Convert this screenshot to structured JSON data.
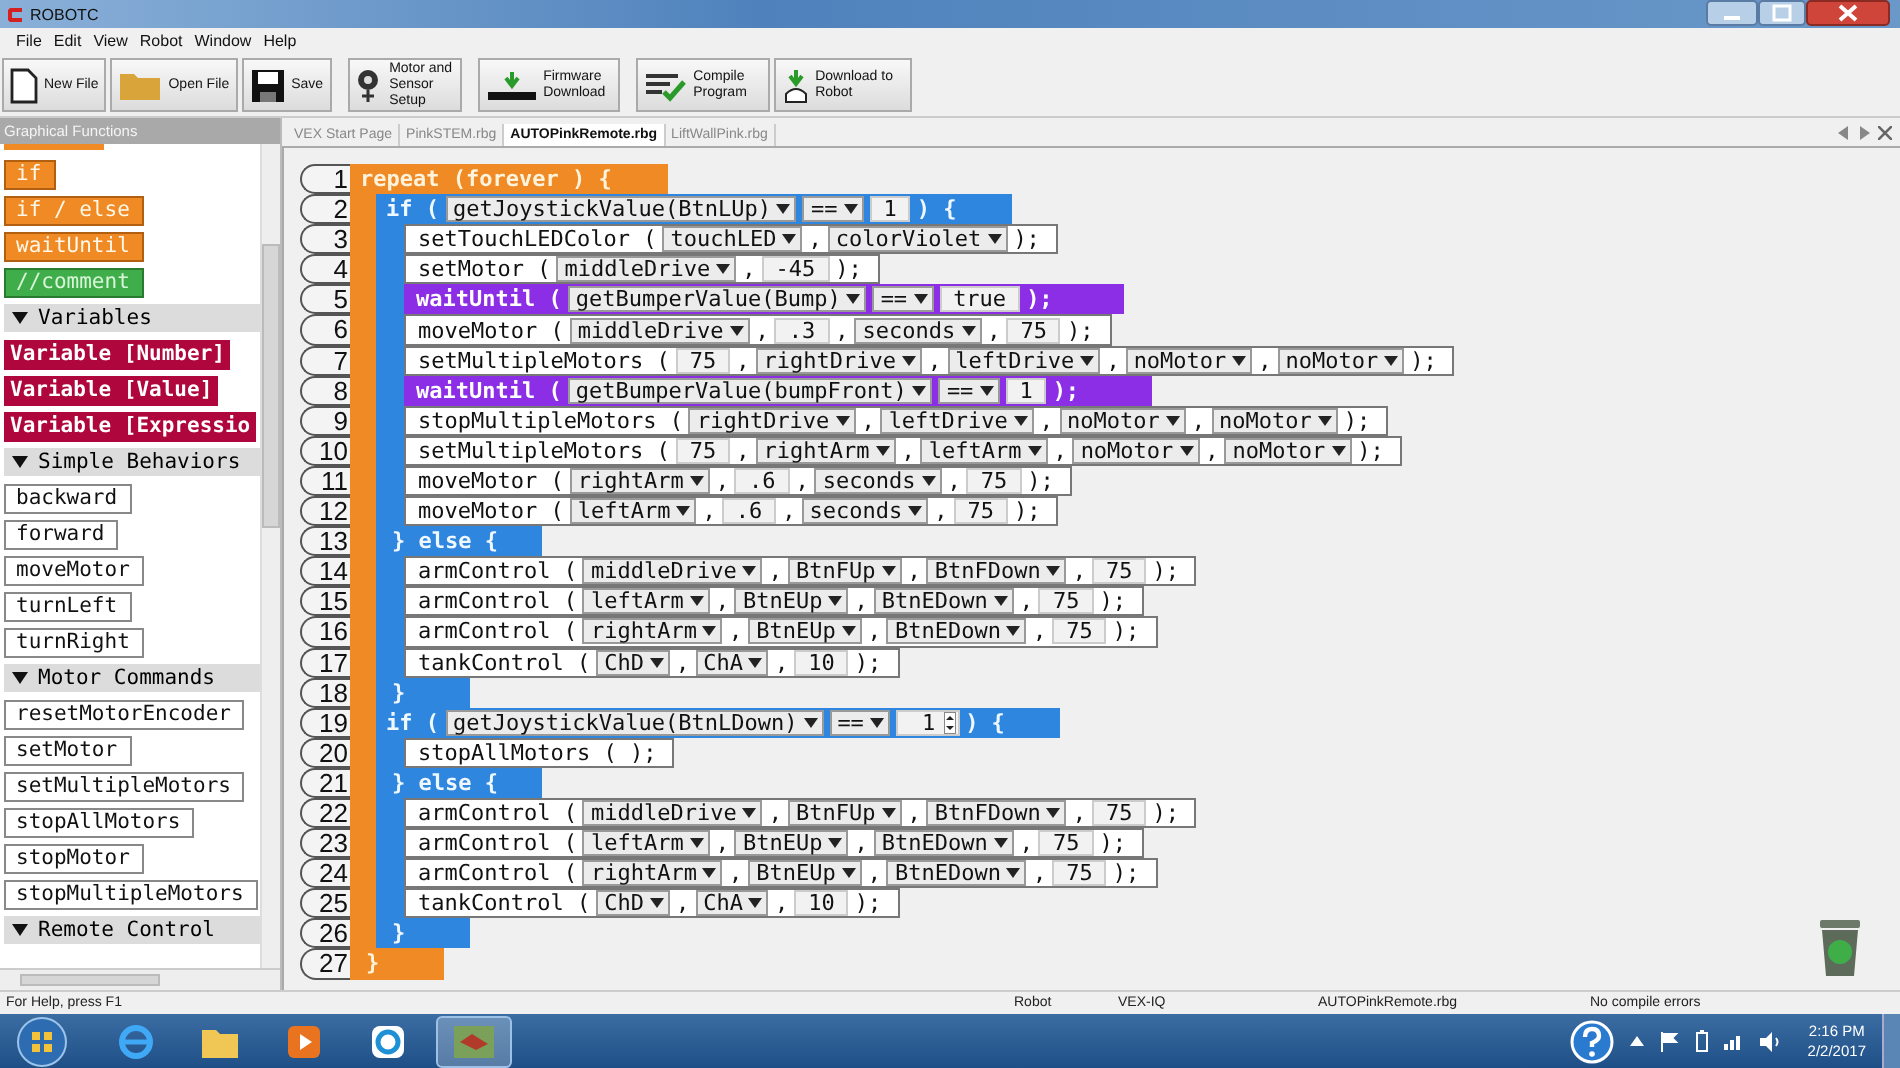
{
  "window": {
    "title": "ROBOTC"
  },
  "menu": [
    "File",
    "Edit",
    "View",
    "Robot",
    "Window",
    "Help"
  ],
  "toolbar": [
    {
      "label": "New File",
      "kind": "new"
    },
    {
      "label": "Open File",
      "kind": "open"
    },
    {
      "label": "Save",
      "kind": "save"
    },
    {
      "label": "Motor and Sensor Setup",
      "kind": "setup"
    },
    {
      "label": "Firmware Download",
      "kind": "firmware"
    },
    {
      "label": "Compile Program",
      "kind": "compile"
    },
    {
      "label": "Download to Robot",
      "kind": "download"
    }
  ],
  "sidebar": {
    "title": "Graphical Functions",
    "groups": [
      {
        "items": [
          {
            "label": "if",
            "kind": "control"
          },
          {
            "label": "if / else",
            "kind": "control"
          },
          {
            "label": "waitUntil",
            "kind": "control"
          },
          {
            "label": "//comment",
            "kind": "comment"
          }
        ]
      },
      {
        "title": "Variables",
        "expanded": true,
        "items": [
          {
            "label": "Variable [Number]",
            "kind": "variable"
          },
          {
            "label": "Variable [Value]",
            "kind": "variable"
          },
          {
            "label": "Variable [Expressio",
            "kind": "variable"
          }
        ]
      },
      {
        "title": "Simple Behaviors",
        "expanded": true,
        "items": [
          {
            "label": "backward",
            "kind": "command"
          },
          {
            "label": "forward",
            "kind": "command"
          },
          {
            "label": "moveMotor",
            "kind": "command"
          },
          {
            "label": "turnLeft",
            "kind": "command"
          },
          {
            "label": "turnRight",
            "kind": "command"
          }
        ]
      },
      {
        "title": "Motor Commands",
        "expanded": true,
        "items": [
          {
            "label": "resetMotorEncoder",
            "kind": "command"
          },
          {
            "label": "setMotor",
            "kind": "command"
          },
          {
            "label": "setMultipleMotors",
            "kind": "command"
          },
          {
            "label": "stopAllMotors",
            "kind": "command"
          },
          {
            "label": "stopMotor",
            "kind": "command"
          },
          {
            "label": "stopMultipleMotors",
            "kind": "command"
          }
        ]
      },
      {
        "title": "Remote Control",
        "expanded": true
      }
    ]
  },
  "tabs": [
    {
      "label": "VEX Start Page",
      "selected": false
    },
    {
      "label": "PinkSTEM.rbg",
      "selected": false
    },
    {
      "label": "AUTOPinkRemote.rbg",
      "selected": true
    },
    {
      "label": "LiftWallPink.rbg",
      "selected": false
    }
  ],
  "code": [
    {
      "num": "1",
      "kind": "repeat",
      "parts": [
        {
          "kind": "text",
          "text": "repeat (forever ) {"
        }
      ],
      "children": [
        {
          "num": "2",
          "kind": "if",
          "parts": [
            {
              "kind": "text",
              "text": "if ("
            },
            {
              "kind": "drop",
              "text": "getJoystickValue(BtnLUp)"
            },
            {
              "kind": "drop",
              "text": "=="
            },
            {
              "kind": "num",
              "text": "1"
            },
            {
              "kind": "text",
              "text": ") {"
            }
          ],
          "children": [
            {
              "num": "3",
              "kind": "statement",
              "parts": [
                {
                  "kind": "text",
                  "text": "setTouchLEDColor ("
                },
                {
                  "kind": "drop",
                  "text": "touchLED"
                },
                {
                  "kind": "text",
                  "text": ","
                },
                {
                  "kind": "drop",
                  "text": "colorViolet"
                },
                {
                  "kind": "text",
                  "text": ");"
                }
              ]
            },
            {
              "num": "4",
              "kind": "statement",
              "parts": [
                {
                  "kind": "text",
                  "text": "setMotor ("
                },
                {
                  "kind": "drop",
                  "text": "middleDrive"
                },
                {
                  "kind": "text",
                  "text": ","
                },
                {
                  "kind": "num",
                  "text": "-45"
                },
                {
                  "kind": "text",
                  "text": ");"
                }
              ]
            },
            {
              "num": "5",
              "kind": "wait",
              "parts": [
                {
                  "kind": "text",
                  "text": "waitUntil ("
                },
                {
                  "kind": "drop",
                  "text": "getBumperValue(Bump)"
                },
                {
                  "kind": "drop",
                  "text": "=="
                },
                {
                  "kind": "num",
                  "text": "true"
                },
                {
                  "kind": "text",
                  "text": ");"
                }
              ]
            },
            {
              "num": "6",
              "kind": "statement",
              "parts": [
                {
                  "kind": "text",
                  "text": "moveMotor ("
                },
                {
                  "kind": "drop",
                  "text": "middleDrive"
                },
                {
                  "kind": "text",
                  "text": ","
                },
                {
                  "kind": "num",
                  "text": ".3"
                },
                {
                  "kind": "text",
                  "text": ","
                },
                {
                  "kind": "drop",
                  "text": "seconds"
                },
                {
                  "kind": "text",
                  "text": ","
                },
                {
                  "kind": "num",
                  "text": "75"
                },
                {
                  "kind": "text",
                  "text": ");"
                }
              ]
            },
            {
              "num": "7",
              "kind": "statement",
              "parts": [
                {
                  "kind": "text",
                  "text": "setMultipleMotors ("
                },
                {
                  "kind": "num",
                  "text": "75"
                },
                {
                  "kind": "text",
                  "text": ","
                },
                {
                  "kind": "drop",
                  "text": "rightDrive"
                },
                {
                  "kind": "text",
                  "text": ","
                },
                {
                  "kind": "drop",
                  "text": "leftDrive"
                },
                {
                  "kind": "text",
                  "text": ","
                },
                {
                  "kind": "drop",
                  "text": "noMotor"
                },
                {
                  "kind": "text",
                  "text": ","
                },
                {
                  "kind": "drop",
                  "text": "noMotor"
                },
                {
                  "kind": "text",
                  "text": ");"
                }
              ]
            },
            {
              "num": "8",
              "kind": "wait",
              "parts": [
                {
                  "kind": "text",
                  "text": "waitUntil ("
                },
                {
                  "kind": "drop",
                  "text": "getBumperValue(bumpFront)"
                },
                {
                  "kind": "drop",
                  "text": "=="
                },
                {
                  "kind": "num",
                  "text": "1"
                },
                {
                  "kind": "text",
                  "text": ");"
                }
              ]
            },
            {
              "num": "9",
              "kind": "statement",
              "parts": [
                {
                  "kind": "text",
                  "text": "stopMultipleMotors ("
                },
                {
                  "kind": "drop",
                  "text": "rightDrive"
                },
                {
                  "kind": "text",
                  "text": ","
                },
                {
                  "kind": "drop",
                  "text": "leftDrive"
                },
                {
                  "kind": "text",
                  "text": ","
                },
                {
                  "kind": "drop",
                  "text": "noMotor"
                },
                {
                  "kind": "text",
                  "text": ","
                },
                {
                  "kind": "drop",
                  "text": "noMotor"
                },
                {
                  "kind": "text",
                  "text": ");"
                }
              ]
            },
            {
              "num": "10",
              "kind": "statement",
              "parts": [
                {
                  "kind": "text",
                  "text": "setMultipleMotors ("
                },
                {
                  "kind": "num",
                  "text": "75"
                },
                {
                  "kind": "text",
                  "text": ","
                },
                {
                  "kind": "drop",
                  "text": "rightArm"
                },
                {
                  "kind": "text",
                  "text": ","
                },
                {
                  "kind": "drop",
                  "text": "leftArm"
                },
                {
                  "kind": "text",
                  "text": ","
                },
                {
                  "kind": "drop",
                  "text": "noMotor"
                },
                {
                  "kind": "text",
                  "text": ","
                },
                {
                  "kind": "drop",
                  "text": "noMotor"
                },
                {
                  "kind": "text",
                  "text": ");"
                }
              ]
            },
            {
              "num": "11",
              "kind": "statement",
              "parts": [
                {
                  "kind": "text",
                  "text": "moveMotor ("
                },
                {
                  "kind": "drop",
                  "text": "rightArm"
                },
                {
                  "kind": "text",
                  "text": ","
                },
                {
                  "kind": "num",
                  "text": ".6"
                },
                {
                  "kind": "text",
                  "text": ","
                },
                {
                  "kind": "drop",
                  "text": "seconds"
                },
                {
                  "kind": "text",
                  "text": ","
                },
                {
                  "kind": "num",
                  "text": "75"
                },
                {
                  "kind": "text",
                  "text": ");"
                }
              ]
            },
            {
              "num": "12",
              "kind": "statement",
              "parts": [
                {
                  "kind": "text",
                  "text": "moveMotor ("
                },
                {
                  "kind": "drop",
                  "text": "leftArm"
                },
                {
                  "kind": "text",
                  "text": ","
                },
                {
                  "kind": "num",
                  "text": ".6"
                },
                {
                  "kind": "text",
                  "text": ","
                },
                {
                  "kind": "drop",
                  "text": "seconds"
                },
                {
                  "kind": "text",
                  "text": ","
                },
                {
                  "kind": "num",
                  "text": "75"
                },
                {
                  "kind": "text",
                  "text": ");"
                }
              ]
            }
          ],
          "else": {
            "num": "13",
            "parts": [
              {
                "kind": "text",
                "text": "} else {"
              }
            ],
            "children": [
              {
                "num": "14",
                "kind": "statement",
                "parts": [
                  {
                    "kind": "text",
                    "text": "armControl ("
                  },
                  {
                    "kind": "drop",
                    "text": "middleDrive"
                  },
                  {
                    "kind": "text",
                    "text": ","
                  },
                  {
                    "kind": "drop",
                    "text": "BtnFUp"
                  },
                  {
                    "kind": "text",
                    "text": ","
                  },
                  {
                    "kind": "drop",
                    "text": "BtnFDown"
                  },
                  {
                    "kind": "text",
                    "text": ","
                  },
                  {
                    "kind": "num",
                    "text": "75"
                  },
                  {
                    "kind": "text",
                    "text": ");"
                  }
                ]
              },
              {
                "num": "15",
                "kind": "statement",
                "parts": [
                  {
                    "kind": "text",
                    "text": "armControl ("
                  },
                  {
                    "kind": "drop",
                    "text": "leftArm"
                  },
                  {
                    "kind": "text",
                    "text": ","
                  },
                  {
                    "kind": "drop",
                    "text": "BtnEUp"
                  },
                  {
                    "kind": "text",
                    "text": ","
                  },
                  {
                    "kind": "drop",
                    "text": "BtnEDown"
                  },
                  {
                    "kind": "text",
                    "text": ","
                  },
                  {
                    "kind": "num",
                    "text": "75"
                  },
                  {
                    "kind": "text",
                    "text": ");"
                  }
                ]
              },
              {
                "num": "16",
                "kind": "statement",
                "parts": [
                  {
                    "kind": "text",
                    "text": "armControl ("
                  },
                  {
                    "kind": "drop",
                    "text": "rightArm"
                  },
                  {
                    "kind": "text",
                    "text": ","
                  },
                  {
                    "kind": "drop",
                    "text": "BtnEUp"
                  },
                  {
                    "kind": "text",
                    "text": ","
                  },
                  {
                    "kind": "drop",
                    "text": "BtnEDown"
                  },
                  {
                    "kind": "text",
                    "text": ","
                  },
                  {
                    "kind": "num",
                    "text": "75"
                  },
                  {
                    "kind": "text",
                    "text": ");"
                  }
                ]
              },
              {
                "num": "17",
                "kind": "statement",
                "parts": [
                  {
                    "kind": "text",
                    "text": "tankControl ("
                  },
                  {
                    "kind": "drop",
                    "text": "ChD"
                  },
                  {
                    "kind": "text",
                    "text": ","
                  },
                  {
                    "kind": "drop",
                    "text": "ChA"
                  },
                  {
                    "kind": "text",
                    "text": ","
                  },
                  {
                    "kind": "num",
                    "text": "10"
                  },
                  {
                    "kind": "text",
                    "text": ");"
                  }
                ]
              }
            ]
          },
          "end": {
            "num": "18",
            "text": "}"
          }
        },
        {
          "num": "19",
          "kind": "if",
          "parts": [
            {
              "kind": "text",
              "text": "if ("
            },
            {
              "kind": "drop",
              "text": "getJoystickValue(BtnLDown)"
            },
            {
              "kind": "drop",
              "text": "=="
            },
            {
              "kind": "spin",
              "text": "1"
            },
            {
              "kind": "text",
              "text": ") {"
            }
          ],
          "children": [
            {
              "num": "20",
              "kind": "statement",
              "parts": [
                {
                  "kind": "text",
                  "text": "stopAllMotors ( );"
                }
              ]
            }
          ],
          "else": {
            "num": "21",
            "parts": [
              {
                "kind": "text",
                "text": "} else {"
              }
            ],
            "children": [
              {
                "num": "22",
                "kind": "statement",
                "parts": [
                  {
                    "kind": "text",
                    "text": "armControl ("
                  },
                  {
                    "kind": "drop",
                    "text": "middleDrive"
                  },
                  {
                    "kind": "text",
                    "text": ","
                  },
                  {
                    "kind": "drop",
                    "text": "BtnFUp"
                  },
                  {
                    "kind": "text",
                    "text": ","
                  },
                  {
                    "kind": "drop",
                    "text": "BtnFDown"
                  },
                  {
                    "kind": "text",
                    "text": ","
                  },
                  {
                    "kind": "num",
                    "text": "75"
                  },
                  {
                    "kind": "text",
                    "text": ");"
                  }
                ]
              },
              {
                "num": "23",
                "kind": "statement",
                "parts": [
                  {
                    "kind": "text",
                    "text": "armControl ("
                  },
                  {
                    "kind": "drop",
                    "text": "leftArm"
                  },
                  {
                    "kind": "text",
                    "text": ","
                  },
                  {
                    "kind": "drop",
                    "text": "BtnEUp"
                  },
                  {
                    "kind": "text",
                    "text": ","
                  },
                  {
                    "kind": "drop",
                    "text": "BtnEDown"
                  },
                  {
                    "kind": "text",
                    "text": ","
                  },
                  {
                    "kind": "num",
                    "text": "75"
                  },
                  {
                    "kind": "text",
                    "text": ");"
                  }
                ]
              },
              {
                "num": "24",
                "kind": "statement",
                "parts": [
                  {
                    "kind": "text",
                    "text": "armControl ("
                  },
                  {
                    "kind": "drop",
                    "text": "rightArm"
                  },
                  {
                    "kind": "text",
                    "text": ","
                  },
                  {
                    "kind": "drop",
                    "text": "BtnEUp"
                  },
                  {
                    "kind": "text",
                    "text": ","
                  },
                  {
                    "kind": "drop",
                    "text": "BtnEDown"
                  },
                  {
                    "kind": "text",
                    "text": ","
                  },
                  {
                    "kind": "num",
                    "text": "75"
                  },
                  {
                    "kind": "text",
                    "text": ");"
                  }
                ]
              },
              {
                "num": "25",
                "kind": "statement",
                "parts": [
                  {
                    "kind": "text",
                    "text": "tankControl ("
                  },
                  {
                    "kind": "drop",
                    "text": "ChD"
                  },
                  {
                    "kind": "text",
                    "text": ","
                  },
                  {
                    "kind": "drop",
                    "text": "ChA"
                  },
                  {
                    "kind": "text",
                    "text": ","
                  },
                  {
                    "kind": "num",
                    "text": "10"
                  },
                  {
                    "kind": "text",
                    "text": ");"
                  }
                ]
              }
            ]
          },
          "end": {
            "num": "26",
            "text": "}"
          }
        }
      ],
      "end": {
        "num": "27",
        "text": "}"
      }
    }
  ],
  "status_bar": {
    "help": "For Help, press F1",
    "robot_label": "Robot",
    "platform": "VEX-IQ",
    "file": "AUTOPinkRemote.rbg",
    "compile": "No compile errors"
  },
  "clock": {
    "time": "2:16 PM",
    "date": "2/2/2017"
  }
}
